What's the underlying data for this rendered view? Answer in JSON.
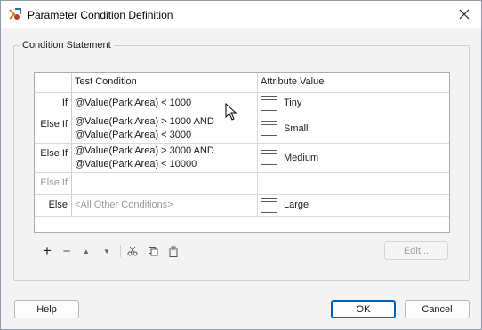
{
  "window": {
    "title": "Parameter Condition Definition"
  },
  "group": {
    "label": "Condition Statement"
  },
  "table": {
    "headers": {
      "condition": "Test Condition",
      "attribute": "Attribute Value"
    },
    "rows": [
      {
        "keyword": "If",
        "lines": [
          "@Value(Park Area) < 1000"
        ],
        "value": "Tiny"
      },
      {
        "keyword": "Else If",
        "lines": [
          "@Value(Park Area) > 1000 AND",
          "@Value(Park Area) < 3000"
        ],
        "value": "Small"
      },
      {
        "keyword": "Else If",
        "lines": [
          "@Value(Park Area) > 3000 AND",
          "@Value(Park Area) < 10000"
        ],
        "value": "Medium"
      },
      {
        "keyword": "Else If",
        "lines": [
          ""
        ],
        "value": ""
      },
      {
        "keyword": "Else",
        "lines": [
          "<All Other Conditions>"
        ],
        "value": "Large"
      }
    ]
  },
  "toolbar": {
    "add": "+",
    "remove": "−",
    "up": "▲",
    "down": "▼",
    "edit_label": "Edit..."
  },
  "buttons": {
    "help": "Help",
    "ok": "OK",
    "cancel": "Cancel"
  }
}
